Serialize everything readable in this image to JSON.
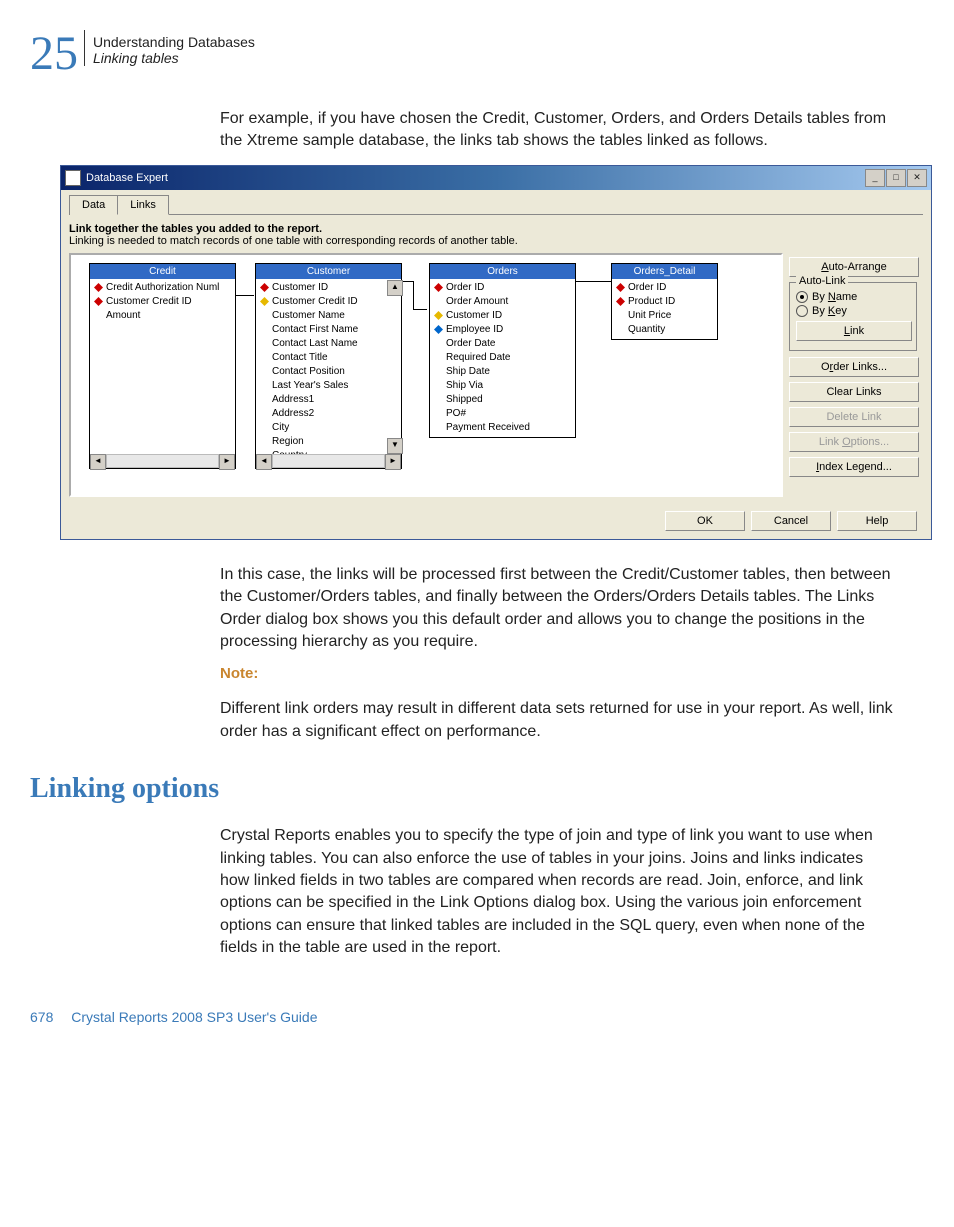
{
  "header": {
    "chapter_number": "25",
    "chapter_title": "Understanding Databases",
    "section_title": "Linking tables"
  },
  "para1": "For example, if you have chosen the Credit, Customer, Orders, and Orders Details tables from the Xtreme sample database, the links tab shows the tables linked as follows.",
  "dialog": {
    "title": "Database Expert",
    "tabs": {
      "data": "Data",
      "links": "Links"
    },
    "instruction_bold": "Link together the tables you added to the report.",
    "instruction_sub": "Linking is needed to match records of one table with corresponding records of another table.",
    "tables": {
      "credit": {
        "title": "Credit",
        "fields": [
          "Credit Authorization Numl",
          "Customer Credit ID",
          "Amount"
        ]
      },
      "customer": {
        "title": "Customer",
        "fields": [
          "Customer ID",
          "Customer Credit ID",
          "Customer Name",
          "Contact First Name",
          "Contact Last Name",
          "Contact Title",
          "Contact Position",
          "Last Year's Sales",
          "Address1",
          "Address2",
          "City",
          "Region",
          "Country"
        ]
      },
      "orders": {
        "title": "Orders",
        "fields": [
          "Order ID",
          "Order Amount",
          "Customer ID",
          "Employee ID",
          "Order Date",
          "Required Date",
          "Ship Date",
          "Ship Via",
          "Shipped",
          "PO#",
          "Payment Received"
        ]
      },
      "orders_detail": {
        "title": "Orders_Detail",
        "fields": [
          "Order ID",
          "Product ID",
          "Unit Price",
          "Quantity"
        ]
      }
    },
    "buttons": {
      "auto_arrange": "Auto-Arrange",
      "order_links": "Order Links...",
      "clear_links": "Clear Links",
      "delete_link": "Delete Link",
      "link_options": "Link Options...",
      "index_legend": "Index Legend...",
      "link": "Link",
      "ok": "OK",
      "cancel": "Cancel",
      "help": "Help"
    },
    "autolink": {
      "label": "Auto-Link",
      "by_name": "By Name",
      "by_key": "By Key"
    }
  },
  "para2": "In this case, the links will be processed first between the Credit/Customer tables, then between the Customer/Orders tables, and finally between the Orders/Orders Details tables. The Links Order dialog box shows you this default order and allows you to change the positions in the processing hierarchy as you require.",
  "note_label": "Note:",
  "para3": "Different link orders may result in different data sets returned for use in your report. As well, link order has a significant effect on performance.",
  "section_heading": "Linking options",
  "para4": "Crystal Reports enables you to specify the type of join and type of link you want to use when linking tables. You can also enforce the use of tables in your joins. Joins and links indicates how linked fields in two tables are compared when records are read. Join, enforce, and link options can be specified in the Link Options dialog box. Using the various join enforcement options can ensure that linked tables are included in the SQL query, even when none of the fields in the table are used in the report.",
  "footer": {
    "page": "678",
    "doc": "Crystal Reports 2008 SP3 User's Guide"
  }
}
